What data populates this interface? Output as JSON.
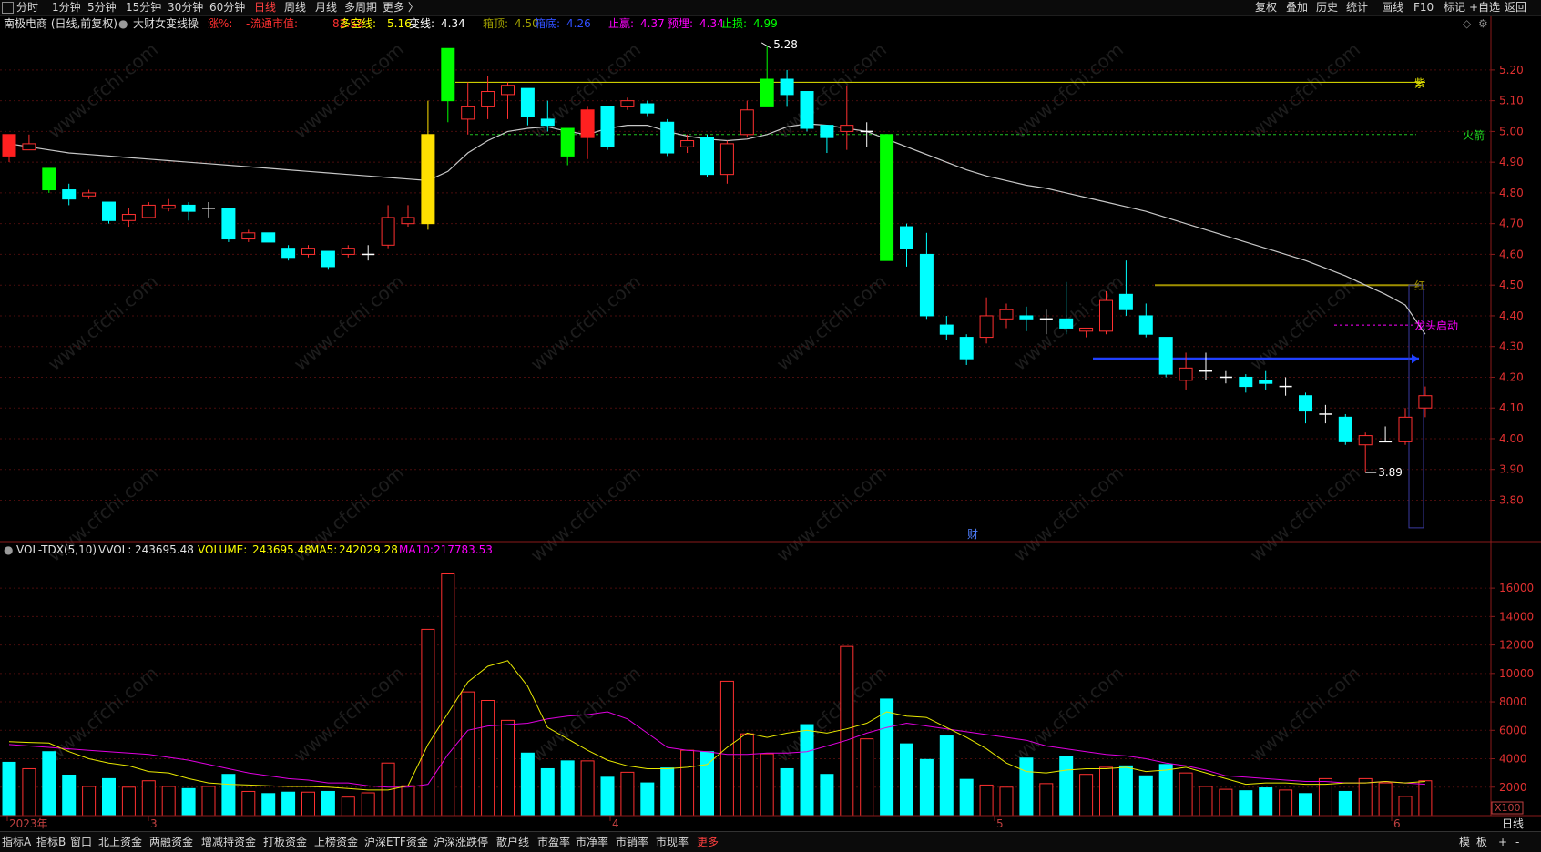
{
  "menu": {
    "period_tabs": [
      "分时",
      "1分钟",
      "5分钟",
      "15分钟",
      "30分钟",
      "60分钟",
      "日线",
      "周线",
      "月线",
      "多周期",
      "更多 〉"
    ],
    "active_tab": "日线",
    "right_tools": [
      "复权",
      "叠加",
      "历史",
      "统计",
      "画线",
      "F10",
      "标记",
      "+自选",
      "返回"
    ]
  },
  "main_panel": {
    "title": "南极电商 (日线,前复权)",
    "indicator_name": "大财女变线操",
    "info_items": [
      {
        "label": "涨%:",
        "value": "-",
        "color": "#ff3030"
      },
      {
        "label": "流通市值:",
        "value": "82.58",
        "color": "#ff3030"
      },
      {
        "label": "多空线:",
        "value": "5.16",
        "color": "#ffff00"
      },
      {
        "label": "变线:",
        "value": "4.34",
        "color": "#ffffff"
      },
      {
        "label": "箱顶:",
        "value": "4.50",
        "color": "#a0a000"
      },
      {
        "label": "箱底:",
        "value": "4.26",
        "color": "#3050ff"
      },
      {
        "label": "止赢:",
        "value": "4.37",
        "color": "#ff00ff"
      },
      {
        "label": "预埋:",
        "value": "4.34",
        "color": "#ff00ff"
      },
      {
        "label": "止损:",
        "value": "4.99",
        "color": "#00ff00"
      }
    ],
    "high_marker": "5.28",
    "low_marker": "3.89",
    "labels": {
      "zi": "紫",
      "huojian": "火箭",
      "hong": "红",
      "longtou": "龙头启动",
      "cai": "财"
    },
    "price_ticks": [
      "5.20",
      "5.10",
      "5.00",
      "4.90",
      "4.80",
      "4.70",
      "4.60",
      "4.50",
      "4.40",
      "4.30",
      "4.20",
      "4.10",
      "4.00",
      "3.90",
      "3.80"
    ],
    "levels": {
      "purple_line": 5.16,
      "rocket_line": 4.99,
      "box_top": 4.5,
      "stop_win": 4.37,
      "box_bottom": 4.26
    }
  },
  "volume_panel": {
    "title": "VOL-TDX(5,10)",
    "vvol_label": "VVOL:",
    "vvol_value": "243695.48",
    "volume_label": "VOLUME:",
    "volume_value": "243695.48",
    "ma5_label": "MA5:",
    "ma5_value": "242029.28",
    "ma10_label": "MA10:",
    "ma10_value": "217783.53",
    "ticks": [
      "16000",
      "14000",
      "12000",
      "10000",
      "8000",
      "6000",
      "4000",
      "2000"
    ],
    "unit": "X100"
  },
  "x_axis": {
    "labels": [
      "2023年",
      "3",
      "4",
      "5",
      "6"
    ],
    "current_period": "日线"
  },
  "bottom_tabs": [
    "指标A",
    "指标B",
    "窗口",
    "北上资金",
    "两融资金",
    "增减持资金",
    "打板资金",
    "上榜资金",
    "沪深ETF资金",
    "沪深涨跌停",
    "散户线",
    "市盈率",
    "市净率",
    "市销率",
    "市现率",
    "更多"
  ],
  "bottom_right": [
    "模",
    "板",
    "+",
    "-"
  ],
  "watermark": "www.cfchi.com",
  "chart_data": {
    "type": "candlestick",
    "series": [
      {
        "name": "K",
        "values": [
          [
            4.99,
            4.92,
            4.99,
            4.9
          ],
          [
            4.94,
            4.96,
            4.99,
            4.94
          ],
          [
            4.88,
            4.81,
            4.88,
            4.8
          ],
          [
            4.81,
            4.78,
            4.83,
            4.76
          ],
          [
            4.79,
            4.8,
            4.81,
            4.78
          ],
          [
            4.77,
            4.71,
            4.77,
            4.7
          ],
          [
            4.71,
            4.73,
            4.75,
            4.69
          ],
          [
            4.72,
            4.76,
            4.77,
            4.72
          ],
          [
            4.75,
            4.76,
            4.78,
            4.74
          ],
          [
            4.76,
            4.74,
            4.77,
            4.71
          ],
          [
            4.75,
            4.75,
            4.77,
            4.72
          ],
          [
            4.75,
            4.65,
            4.75,
            4.64
          ],
          [
            4.65,
            4.67,
            4.68,
            4.64
          ],
          [
            4.67,
            4.64,
            4.67,
            4.64
          ],
          [
            4.62,
            4.59,
            4.63,
            4.58
          ],
          [
            4.6,
            4.62,
            4.63,
            4.59
          ],
          [
            4.61,
            4.56,
            4.61,
            4.55
          ],
          [
            4.6,
            4.62,
            4.63,
            4.59
          ],
          [
            4.6,
            4.6,
            4.63,
            4.58
          ],
          [
            4.63,
            4.72,
            4.76,
            4.62
          ],
          [
            4.7,
            4.72,
            4.76,
            4.69
          ],
          [
            4.7,
            4.99,
            5.1,
            4.68
          ],
          [
            5.1,
            5.27,
            5.27,
            5.03
          ],
          [
            5.04,
            5.08,
            5.16,
            4.99
          ],
          [
            5.08,
            5.13,
            5.18,
            5.04
          ],
          [
            5.12,
            5.15,
            5.16,
            5.04
          ],
          [
            5.14,
            5.05,
            5.14,
            5.02
          ],
          [
            5.04,
            5.02,
            5.1,
            5.0
          ],
          [
            5.01,
            4.92,
            5.01,
            4.89
          ],
          [
            4.98,
            5.07,
            5.08,
            4.91
          ],
          [
            5.08,
            4.95,
            5.08,
            4.94
          ],
          [
            5.08,
            5.1,
            5.11,
            5.07
          ],
          [
            5.09,
            5.06,
            5.1,
            5.05
          ],
          [
            5.03,
            4.93,
            5.04,
            4.92
          ],
          [
            4.95,
            4.97,
            4.99,
            4.93
          ],
          [
            4.98,
            4.86,
            4.99,
            4.85
          ],
          [
            4.86,
            4.96,
            4.97,
            4.83
          ],
          [
            4.99,
            5.07,
            5.1,
            4.98
          ],
          [
            5.08,
            5.17,
            5.28,
            5.09
          ],
          [
            5.17,
            5.12,
            5.2,
            5.08
          ],
          [
            5.13,
            5.01,
            5.13,
            5.0
          ],
          [
            5.02,
            4.98,
            5.02,
            4.93
          ],
          [
            5.0,
            5.02,
            5.15,
            4.94
          ],
          [
            5.0,
            5.0,
            5.03,
            4.95
          ],
          [
            4.99,
            4.58,
            4.99,
            4.58
          ],
          [
            4.69,
            4.62,
            4.7,
            4.56
          ],
          [
            4.6,
            4.4,
            4.67,
            4.39
          ],
          [
            4.37,
            4.34,
            4.4,
            4.32
          ],
          [
            4.33,
            4.26,
            4.34,
            4.24
          ],
          [
            4.33,
            4.4,
            4.46,
            4.31
          ],
          [
            4.39,
            4.42,
            4.44,
            4.36
          ],
          [
            4.4,
            4.39,
            4.43,
            4.35
          ],
          [
            4.39,
            4.39,
            4.42,
            4.34
          ],
          [
            4.39,
            4.36,
            4.51,
            4.34
          ],
          [
            4.35,
            4.36,
            4.36,
            4.33
          ],
          [
            4.35,
            4.45,
            4.48,
            4.34
          ],
          [
            4.47,
            4.42,
            4.58,
            4.4
          ],
          [
            4.4,
            4.34,
            4.44,
            4.33
          ],
          [
            4.33,
            4.21,
            4.33,
            4.2
          ],
          [
            4.19,
            4.23,
            4.28,
            4.16
          ],
          [
            4.22,
            4.22,
            4.28,
            4.19
          ],
          [
            4.2,
            4.2,
            4.22,
            4.18
          ],
          [
            4.2,
            4.17,
            4.21,
            4.15
          ],
          [
            4.19,
            4.18,
            4.22,
            4.16
          ],
          [
            4.17,
            4.17,
            4.2,
            4.14
          ],
          [
            4.14,
            4.09,
            4.15,
            4.05
          ],
          [
            4.08,
            4.08,
            4.11,
            4.05
          ],
          [
            4.07,
            3.99,
            4.08,
            3.98
          ],
          [
            3.98,
            4.01,
            4.02,
            3.89
          ],
          [
            3.99,
            3.99,
            4.04,
            3.99
          ],
          [
            3.99,
            4.07,
            4.1,
            3.98
          ],
          [
            4.1,
            4.14,
            4.17,
            4.07
          ]
        ]
      },
      {
        "name": "变线",
        "values": [
          4.96,
          4.95,
          4.94,
          4.93,
          4.925,
          4.92,
          4.915,
          4.91,
          4.905,
          4.9,
          4.895,
          4.89,
          4.885,
          4.88,
          4.875,
          4.87,
          4.865,
          4.86,
          4.855,
          4.85,
          4.845,
          4.84,
          4.87,
          4.93,
          4.97,
          5.0,
          5.01,
          5.015,
          5.0,
          4.99,
          5.01,
          5.02,
          5.02,
          5.0,
          4.985,
          4.975,
          4.97,
          4.975,
          4.99,
          5.015,
          5.025,
          5.02,
          5.01,
          5.0,
          4.975,
          4.95,
          4.925,
          4.9,
          4.875,
          4.855,
          4.84,
          4.825,
          4.815,
          4.8,
          4.785,
          4.77,
          4.755,
          4.74,
          4.72,
          4.7,
          4.68,
          4.66,
          4.64,
          4.62,
          4.6,
          4.58,
          4.555,
          4.53,
          4.5,
          4.47,
          4.435,
          4.34
        ]
      },
      {
        "name": "VOLUME",
        "values": [
          3750,
          3300,
          4500,
          2850,
          2050,
          2600,
          2000,
          2450,
          2050,
          1900,
          2050,
          2900,
          1700,
          1550,
          1650,
          1650,
          1700,
          1300,
          1600,
          3700,
          2100,
          13100,
          17000,
          8700,
          8100,
          6700,
          4400,
          3300,
          3850,
          3850,
          2700,
          3050,
          2300,
          3350,
          4600,
          4500,
          9450,
          5750,
          4350,
          3300,
          6400,
          2900,
          11900,
          5400,
          8200,
          5050,
          3950,
          5600,
          2550,
          2150,
          2000,
          4050,
          2250,
          4150,
          2900,
          3400,
          3500,
          2800,
          3600,
          3000,
          2050,
          1850,
          1750,
          1950,
          1800,
          1550,
          2600,
          1700,
          2600,
          2300,
          1350,
          2450
        ]
      },
      {
        "name": "MA5",
        "values": [
          5200,
          5150,
          5100,
          4500,
          4000,
          3700,
          3500,
          3100,
          3000,
          2600,
          2300,
          2200,
          2150,
          2100,
          2050,
          2050,
          2000,
          1900,
          1800,
          1800,
          2100,
          5000,
          7200,
          9400,
          10500,
          10900,
          9100,
          6200,
          5400,
          4600,
          3900,
          3500,
          3300,
          3300,
          3400,
          3600,
          4800,
          5800,
          5500,
          5800,
          6000,
          5800,
          6100,
          6500,
          7300,
          7000,
          6900,
          6200,
          5500,
          4700,
          3700,
          3100,
          3000,
          3200,
          3300,
          3300,
          3400,
          3100,
          3200,
          3400,
          3000,
          2600,
          2200,
          2300,
          2300,
          2200,
          2200,
          2300,
          2300,
          2400,
          2300,
          2400
        ]
      },
      {
        "name": "MA10",
        "values": [
          5000,
          4900,
          4800,
          4700,
          4600,
          4500,
          4400,
          4300,
          4100,
          3900,
          3600,
          3300,
          3000,
          2800,
          2600,
          2500,
          2300,
          2300,
          2100,
          2000,
          2000,
          2200,
          4300,
          6000,
          6300,
          6400,
          6500,
          6800,
          7000,
          7100,
          7300,
          6800,
          5800,
          4800,
          4600,
          4500,
          4300,
          4300,
          4400,
          4400,
          4500,
          4900,
          5300,
          5800,
          6200,
          6500,
          6300,
          6100,
          5900,
          5700,
          5500,
          5300,
          4900,
          4700,
          4500,
          4300,
          4200,
          4000,
          3700,
          3500,
          3200,
          2800,
          2700,
          2600,
          2500,
          2400,
          2400,
          2300,
          2300,
          2400,
          2300,
          2200
        ]
      }
    ],
    "y_range_price": [
      3.68,
      5.33
    ],
    "y_range_volume": [
      0,
      17800
    ],
    "grid": true
  }
}
